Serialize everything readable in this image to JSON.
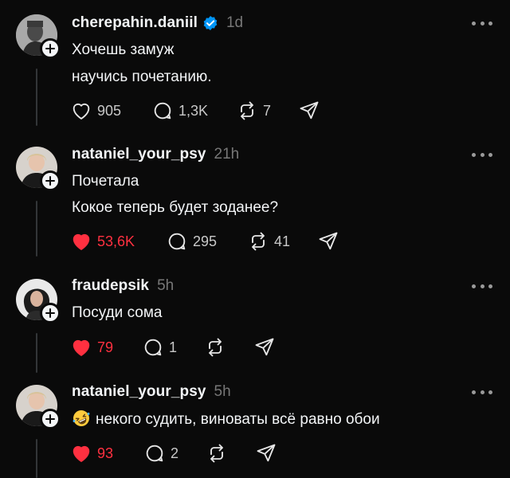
{
  "posts": [
    {
      "username": "cherepahin.daniil",
      "verified": true,
      "time": "1d",
      "lines": [
        "Хочешь замуж",
        "научись почетанию."
      ],
      "liked": false,
      "likes": "905",
      "replies": "1,3K",
      "reposts": "7",
      "icons": [
        "heart-icon",
        "comment-icon",
        "repost-icon",
        "share-icon"
      ]
    },
    {
      "username": "nataniel_your_psy",
      "verified": false,
      "time": "21h",
      "lines": [
        "Почетала",
        "Кокое теперь будет зоданее?"
      ],
      "liked": true,
      "likes": "53,6K",
      "replies": "295",
      "reposts": "41"
    },
    {
      "username": "fraudepsik",
      "verified": false,
      "time": "5h",
      "lines": [
        "Посуди сома"
      ],
      "liked": true,
      "likes": "79",
      "replies": "1",
      "reposts": ""
    },
    {
      "username": "nataniel_your_psy",
      "verified": false,
      "time": "5h",
      "emoji": "rolling-on-floor-laughing-emoji",
      "lines": [
        "некого судить, виноваты всё равно обои"
      ],
      "liked": true,
      "likes": "93",
      "replies": "2",
      "reposts": ""
    }
  ],
  "colors": {
    "background": "#0a0a0a",
    "like": "#ff3040",
    "verified": "#0095f6",
    "muted": "#777777"
  }
}
